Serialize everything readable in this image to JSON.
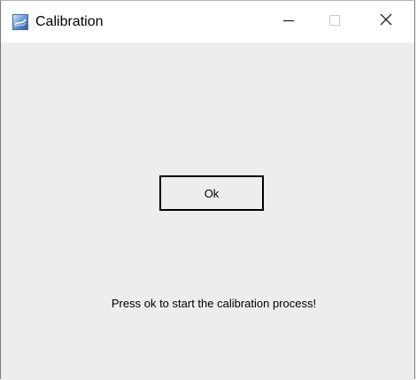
{
  "window": {
    "title": "Calibration",
    "icon": "app-icon",
    "controls": {
      "minimize_icon": "minimize-icon",
      "maximize_icon": "maximize-icon",
      "close_icon": "close-icon",
      "maximize_enabled": false
    }
  },
  "main": {
    "ok_label": "Ok",
    "message": "Press ok to start the calibration process!"
  },
  "colors": {
    "titlebar_bg": "#ffffff",
    "client_bg": "#ecedec",
    "button_border": "#000000",
    "disabled_control": "#c8c8c8"
  }
}
